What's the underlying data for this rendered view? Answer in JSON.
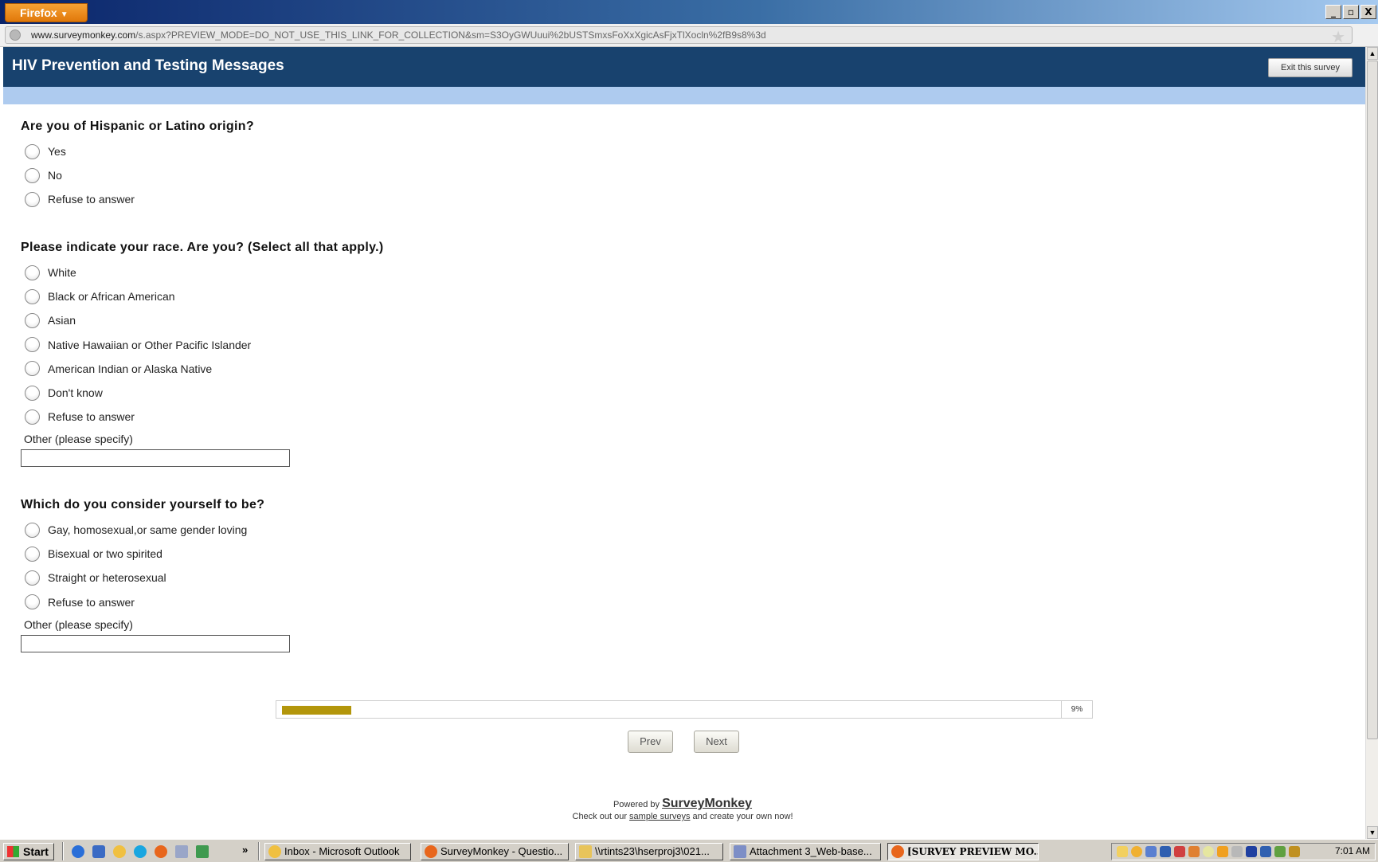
{
  "browser": {
    "menu_button": "Firefox",
    "minimize": "_",
    "restore": "̸",
    "close": "X",
    "url_host": "www.surveymonkey.com",
    "url_rest": "/s.aspx?PREVIEW_MODE=DO_NOT_USE_THIS_LINK_FOR_COLLECTION&sm=S3OyGWUuui%2bUSTSmxsFoXxXgicAsFjxTlXocln%2fB9s8%3d"
  },
  "survey": {
    "title": "HIV Prevention and Testing Messages",
    "exit_label": "Exit this survey"
  },
  "questions": [
    {
      "title": "Are you of Hispanic or Latino origin?",
      "options": [
        "Yes",
        "No",
        "Refuse to answer"
      ]
    },
    {
      "title": "Please indicate your race. Are you? (Select all that apply.)",
      "options": [
        "White",
        "Black or African American",
        "Asian",
        "Native Hawaiian or Other Pacific Islander",
        "American Indian or Alaska Native",
        "Don't know",
        "Refuse to answer"
      ],
      "other_label": "Other (please specify)",
      "other_value": ""
    },
    {
      "title": "Which do you consider yourself to be?",
      "options": [
        "Gay, homosexual,or same gender loving",
        "Bisexual or two spirited",
        "Straight or heterosexual",
        "Refuse to answer"
      ],
      "other_label": "Other (please specify)",
      "other_value": ""
    }
  ],
  "progress": {
    "percent": 9,
    "label": "9%"
  },
  "nav": {
    "prev_label": "Prev",
    "next_label": "Next"
  },
  "footer": {
    "powered_by": "Powered by",
    "brand": "SurveyMonkey",
    "check_out": "Check out our",
    "sample_link": "sample surveys",
    "create": "and create your own now!"
  },
  "taskbar": {
    "start_label": "Start",
    "more": "»",
    "tasks": [
      {
        "label": "Inbox - Microsoft Outlook",
        "icon": "outlook-icon"
      },
      {
        "label": "SurveyMonkey - Questio...",
        "icon": "firefox-icon"
      },
      {
        "label": "\\\\rtints23\\hserproj3\\021...",
        "icon": "folder-icon"
      },
      {
        "label": "Attachment 3_Web-base...",
        "icon": "word-icon"
      },
      {
        "label": "[SURVEY PREVIEW MO...",
        "icon": "firefox-icon",
        "active": true
      }
    ],
    "clock": "7:01 AM"
  },
  "colors": {
    "header_bg": "#18426e",
    "band": "#aecbef",
    "progress_fill": "#b3960b"
  }
}
